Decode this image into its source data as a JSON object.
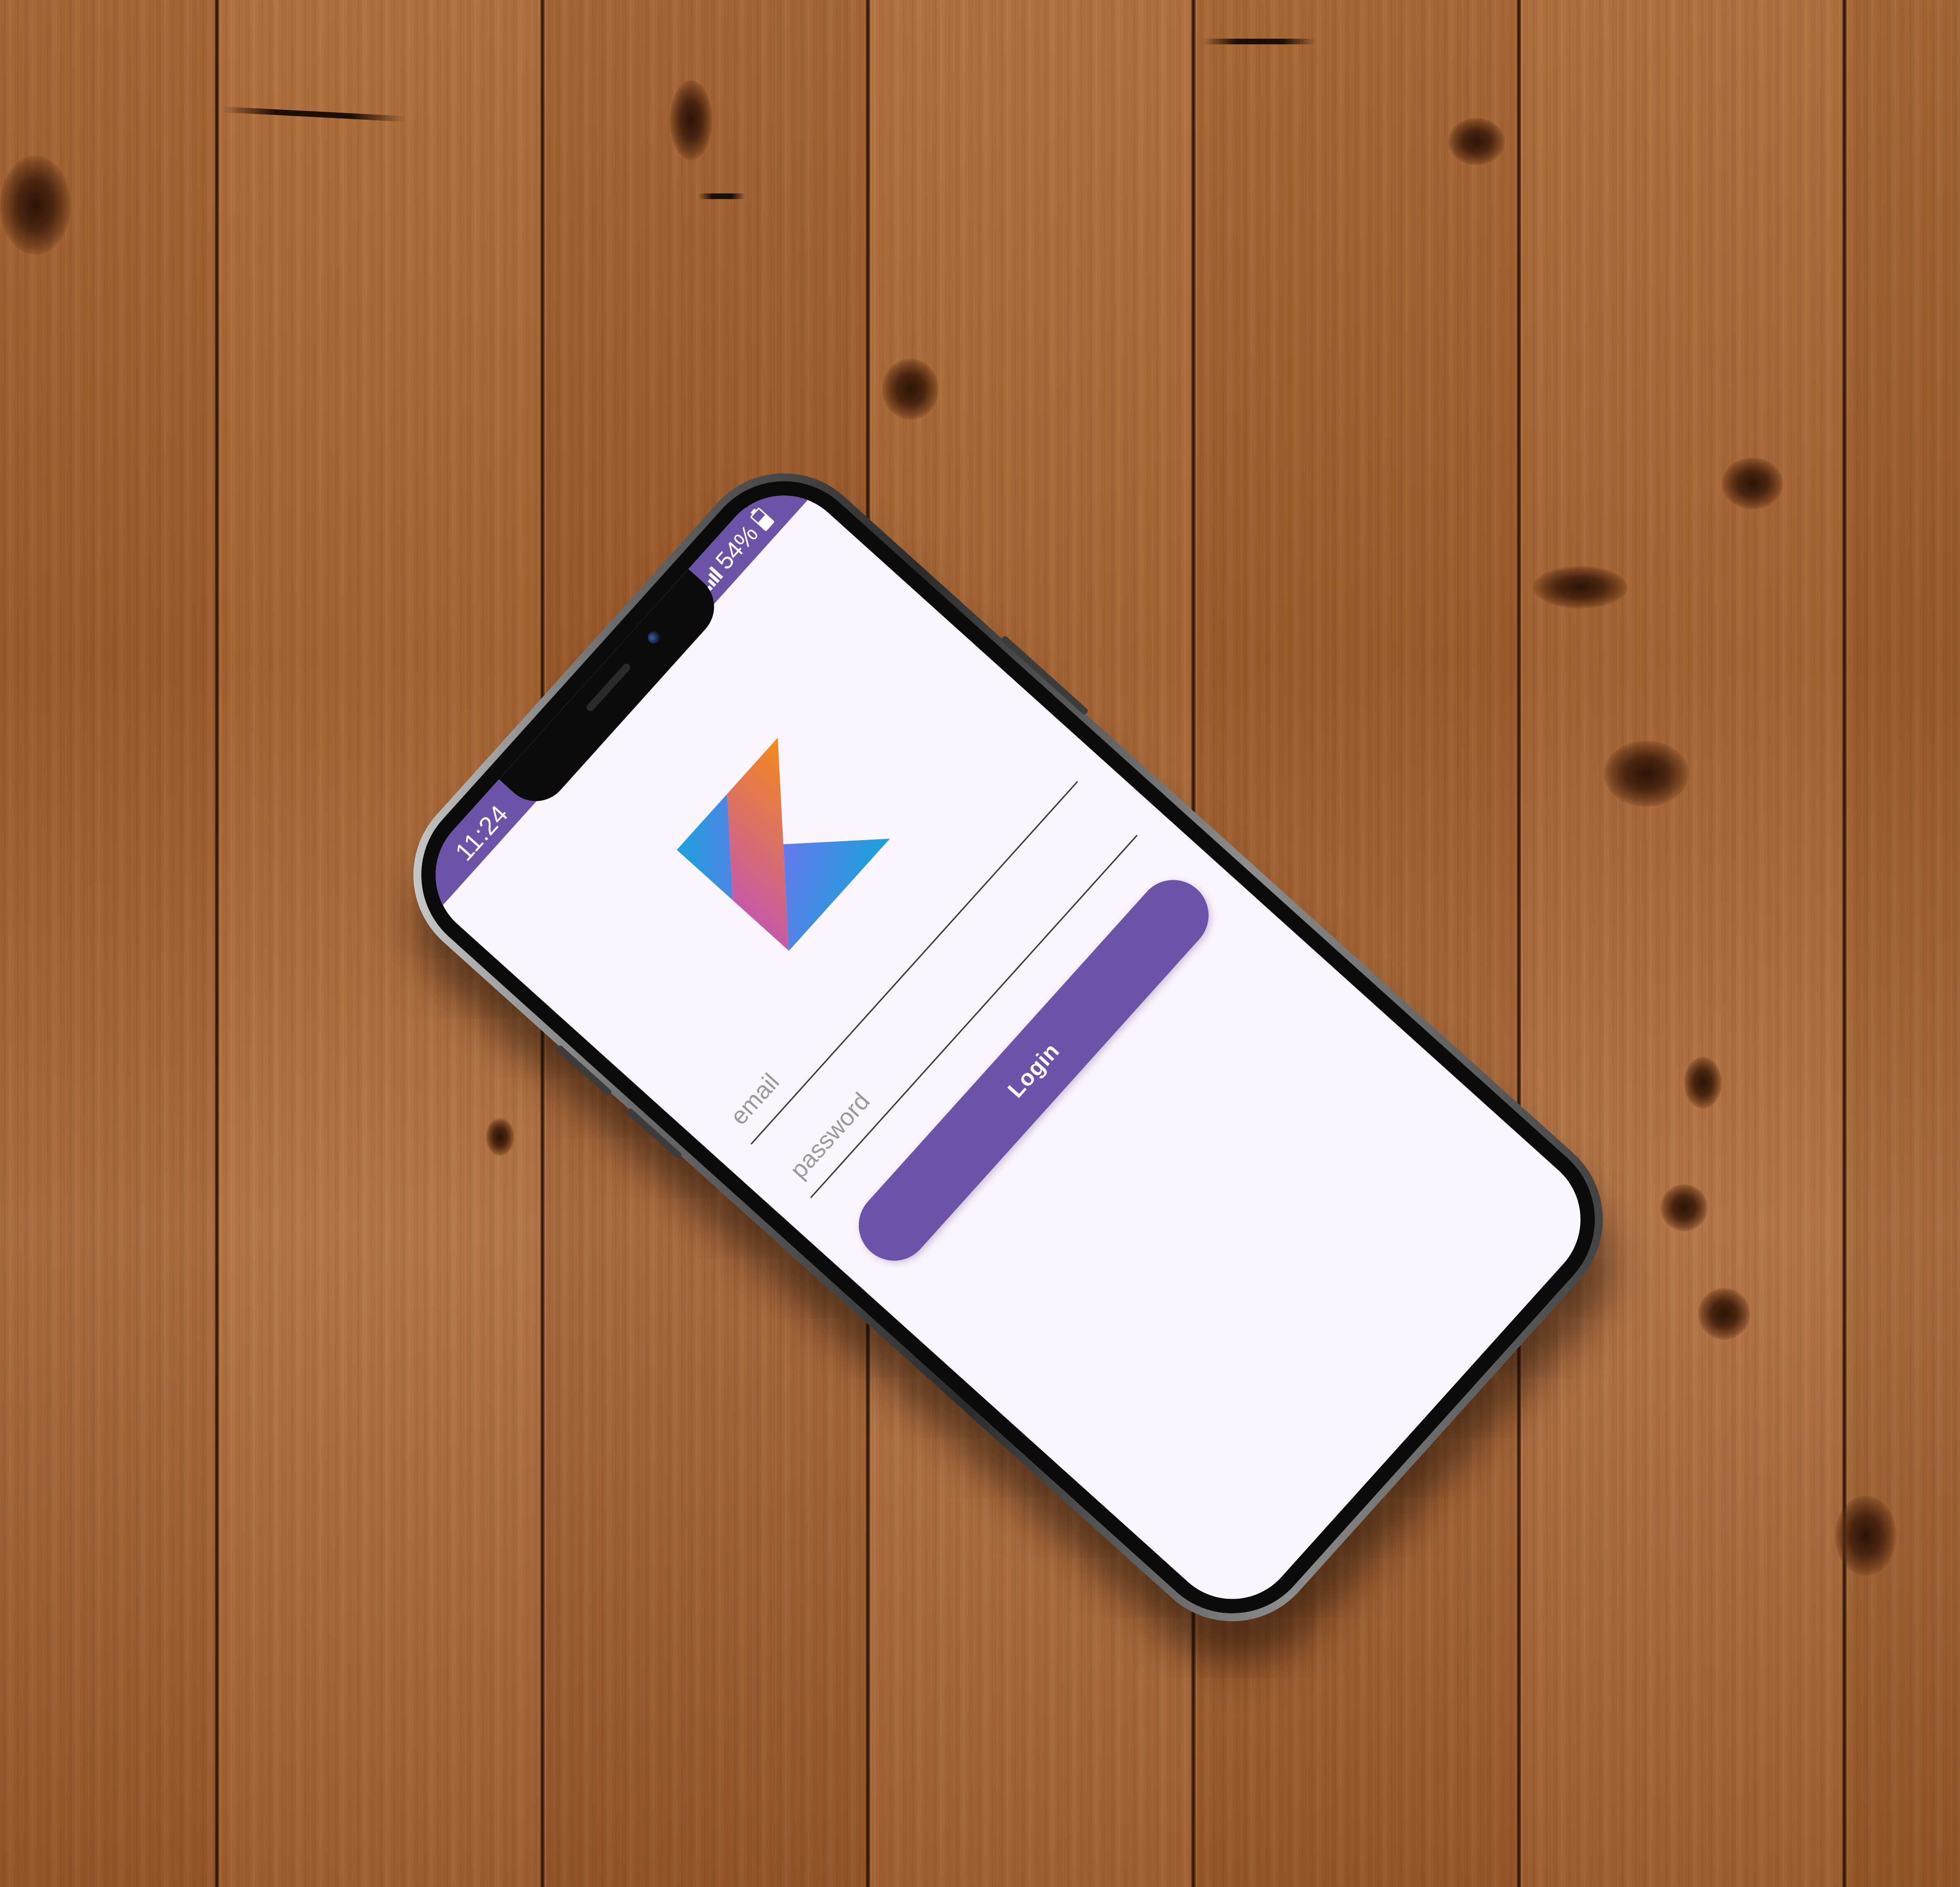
{
  "status_bar": {
    "time": "11:24",
    "network": "4G",
    "battery_percent": "54%",
    "battery_level": 0.54
  },
  "logo": {
    "icon": "kotlin-logo-icon",
    "colors": {
      "blue": "#1ba1dc",
      "violet": "#7f6cf0",
      "magenta": "#c65aa6",
      "orange": "#f48a1a"
    }
  },
  "form": {
    "email_placeholder": "email",
    "password_placeholder": "password",
    "login_label": "Login"
  },
  "theme": {
    "primary": "#6c53a8",
    "background": "#fbf5fd"
  }
}
